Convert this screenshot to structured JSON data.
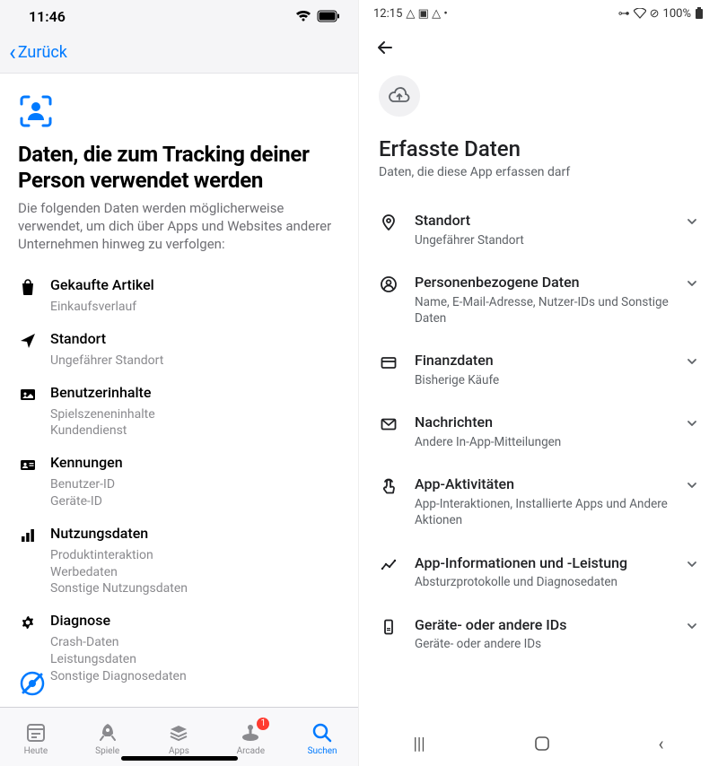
{
  "ios": {
    "status_time": "11:46",
    "back_label": "Zurück",
    "title": "Daten, die zum Tracking deiner Person verwendet werden",
    "subtitle": "Die folgenden Daten werden möglicherweise verwendet, um dich über Apps und Websites anderer Unternehmen hinweg zu verfolgen:",
    "items": [
      {
        "icon": "bag",
        "title": "Gekaufte Artikel",
        "subs": [
          "Einkaufsverlauf"
        ]
      },
      {
        "icon": "location-arrow",
        "title": "Standort",
        "subs": [
          "Ungefährer Standort"
        ]
      },
      {
        "icon": "user-content",
        "title": "Benutzerinhalte",
        "subs": [
          "Spielszeneninhalte",
          "Kundendienst"
        ]
      },
      {
        "icon": "id-card",
        "title": "Kennungen",
        "subs": [
          "Benutzer-ID",
          "Geräte-ID"
        ]
      },
      {
        "icon": "bar-chart",
        "title": "Nutzungsdaten",
        "subs": [
          "Produktinteraktion",
          "Werbedaten",
          "Sonstige Nutzungsdaten"
        ]
      },
      {
        "icon": "gear",
        "title": "Diagnose",
        "subs": [
          "Crash-Daten",
          "Leistungsdaten",
          "Sonstige Diagnosedaten"
        ]
      }
    ],
    "tabs": [
      {
        "label": "Heute",
        "icon": "today",
        "active": false
      },
      {
        "label": "Spiele",
        "icon": "rocket",
        "active": false
      },
      {
        "label": "Apps",
        "icon": "stack",
        "active": false
      },
      {
        "label": "Arcade",
        "icon": "arcade",
        "active": false,
        "badge": "1"
      },
      {
        "label": "Suchen",
        "icon": "search",
        "active": true
      }
    ]
  },
  "android": {
    "status_time": "12:15",
    "status_battery": "100%",
    "title": "Erfasste Daten",
    "subtitle": "Daten, die diese App erfassen darf",
    "items": [
      {
        "icon": "pin",
        "title": "Standort",
        "sub": "Ungefährer Standort"
      },
      {
        "icon": "person",
        "title": "Personenbezogene Daten",
        "sub": "Name, E-Mail-Adresse, Nutzer-IDs und Sonstige Daten"
      },
      {
        "icon": "card",
        "title": "Finanzdaten",
        "sub": "Bisherige Käufe"
      },
      {
        "icon": "mail",
        "title": "Nachrichten",
        "sub": "Andere In-App-Mitteilungen"
      },
      {
        "icon": "touch",
        "title": "App-Aktivitäten",
        "sub": "App-Interaktionen, Installierte Apps und Andere Aktionen"
      },
      {
        "icon": "chart",
        "title": "App-Informationen und -Leistung",
        "sub": "Absturzprotokolle und Diagnosedaten"
      },
      {
        "icon": "device-id",
        "title": "Geräte- oder andere IDs",
        "sub": "Geräte- oder andere IDs"
      }
    ]
  }
}
